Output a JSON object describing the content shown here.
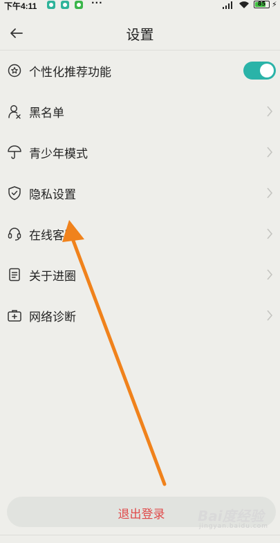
{
  "status_bar": {
    "time": "下午4:11",
    "more": "···",
    "battery": "85",
    "charging_icon": "bolt-icon"
  },
  "header": {
    "title": "设置",
    "back_icon": "back-arrow-icon"
  },
  "settings": [
    {
      "label": "个性化推荐功能",
      "icon": "star-shield-icon",
      "control": "toggle",
      "toggle_on": true
    },
    {
      "label": "黑名单",
      "icon": "user-block-icon",
      "control": "chevron"
    },
    {
      "label": "青少年模式",
      "icon": "umbrella-icon",
      "control": "chevron"
    },
    {
      "label": "隐私设置",
      "icon": "shield-check-icon",
      "control": "chevron"
    },
    {
      "label": "在线客服",
      "icon": "headset-icon",
      "control": "chevron"
    },
    {
      "label": "关于进圈",
      "icon": "document-icon",
      "control": "chevron"
    },
    {
      "label": "网络诊断",
      "icon": "medkit-icon",
      "control": "chevron"
    }
  ],
  "logout_label": "退出登录",
  "watermark": {
    "big": "Bai度经验",
    "small": "jingyan.baidu.com"
  },
  "colors": {
    "accent": "#2ab3a8",
    "danger": "#e04a4a",
    "annotation_arrow": "#f0821c",
    "background": "#eeeeea"
  }
}
